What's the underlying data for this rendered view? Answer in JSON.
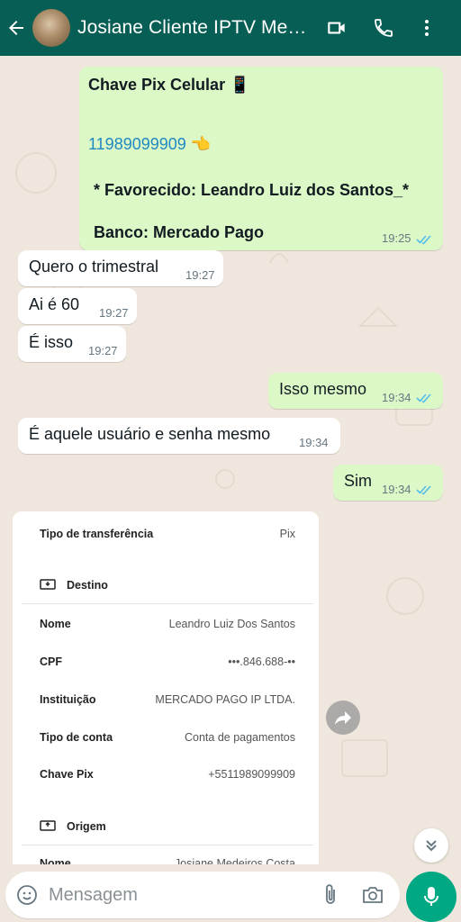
{
  "header": {
    "title": "Josiane Cliente IPTV Medeiros",
    "icons": [
      "back-arrow-icon",
      "avatar",
      "video-call-icon",
      "phone-icon",
      "more-vert-icon"
    ],
    "color": "#075e54"
  },
  "messages": [
    {
      "type": "out",
      "lines": {
        "title": "Chave Pix Celular 📱",
        "phone": "11989099909 👈",
        "favorecido": "* Favorecido: Leandro Luiz dos Santos_*",
        "banco": "Banco: Mercado Pago"
      },
      "time": "19:25",
      "status": "read"
    },
    {
      "type": "in",
      "text": "Quero o trimestral",
      "time": "19:27"
    },
    {
      "type": "in",
      "text": "Ai é 60",
      "time": "19:27"
    },
    {
      "type": "in",
      "text": "É isso",
      "time": "19:27"
    },
    {
      "type": "out",
      "text": "Isso mesmo",
      "time": "19:34",
      "status": "read"
    },
    {
      "type": "in",
      "text": "É aquele usuário e senha mesmo",
      "time": "19:34"
    },
    {
      "type": "out",
      "text": "Sim",
      "time": "19:34",
      "status": "read"
    }
  ],
  "receipt": {
    "transfer_type_label": "Tipo de transferência",
    "transfer_type_value": "Pix",
    "destino_label": "Destino",
    "rows": [
      {
        "label": "Nome",
        "value": "Leandro Luiz Dos Santos"
      },
      {
        "label": "CPF",
        "value": "•••.846.688-••"
      },
      {
        "label": "Instituição",
        "value": "MERCADO PAGO IP LTDA."
      },
      {
        "label": "Tipo de conta",
        "value": "Conta de pagamentos"
      },
      {
        "label": "Chave Pix",
        "value": "+5511989099909"
      }
    ],
    "origem_label": "Origem",
    "origem_row": {
      "label": "Nome",
      "value": "Josiane Medeiros Costa"
    }
  },
  "input": {
    "placeholder": "Mensagem",
    "icons": [
      "emoji-icon",
      "attach-icon",
      "camera-icon",
      "mic-icon"
    ]
  },
  "colors": {
    "outgoing": "#dcf8c6",
    "incoming": "#ffffff",
    "read_ticks": "#53bdeb",
    "link": "#1f8ac2",
    "accent": "#00a884"
  }
}
